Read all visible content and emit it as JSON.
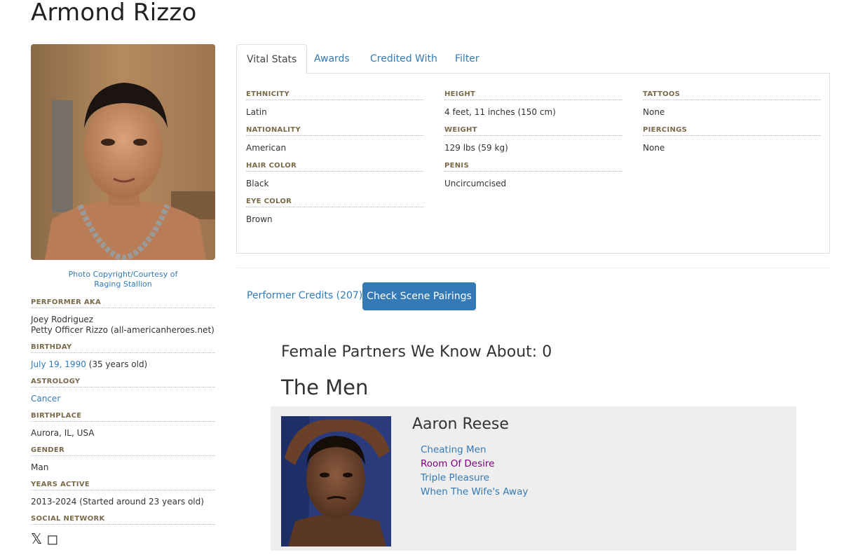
{
  "performer": {
    "name": "Armond Rizzo",
    "photo_credit_line1": "Photo Copyright/Courtesy of",
    "photo_credit_line2": "Raging Stallion"
  },
  "bio": {
    "aka_label": "PERFORMER AKA",
    "aka_1": "Joey Rodriguez",
    "aka_2": "Petty Officer Rizzo (all-americanheroes.net)",
    "birthday_label": "BIRTHDAY",
    "birthday_date": "July 19, 1990",
    "birthday_age": " (35 years old)",
    "astrology_label": "ASTROLOGY",
    "astrology": "Cancer",
    "birthplace_label": "BIRTHPLACE",
    "birthplace": "Aurora, IL, USA",
    "gender_label": "GENDER",
    "gender": "Man",
    "years_active_label": "YEARS ACTIVE",
    "years_active": "2013-2024 (Started around 23 years old)",
    "social_label": "SOCIAL NETWORK"
  },
  "tabs": {
    "vital_stats": "Vital Stats",
    "awards": "Awards",
    "credited_with": "Credited With",
    "filter": "Filter"
  },
  "stats": {
    "ethnicity_label": "ETHNICITY",
    "ethnicity": "Latin",
    "nationality_label": "NATIONALITY",
    "nationality": "American",
    "hair_label": "HAIR COLOR",
    "hair": "Black",
    "eye_label": "EYE COLOR",
    "eye": "Brown",
    "height_label": "HEIGHT",
    "height": "4 feet, 11 inches (150 cm)",
    "weight_label": "WEIGHT",
    "weight": "129 lbs (59 kg)",
    "penis_label": "PENIS",
    "penis": "Uncircumcised",
    "tattoos_label": "TATTOOS",
    "tattoos": "None",
    "piercings_label": "PIERCINGS",
    "piercings": "None"
  },
  "credits": {
    "performer_credits": "Performer Credits (207)",
    "check_pairings": "Check Scene Pairings",
    "female_partners": "Female Partners We Know About: 0",
    "men_heading": "The Men"
  },
  "partner": {
    "name": "Aaron Reese",
    "scenes": [
      "Cheating Men",
      "Room Of Desire",
      "Triple Pleasure",
      "When The Wife's Away"
    ]
  },
  "colors": {
    "link": "#337ab7",
    "visited_link": "#800080",
    "button": "#337ab7",
    "label": "#7a6a4a"
  }
}
